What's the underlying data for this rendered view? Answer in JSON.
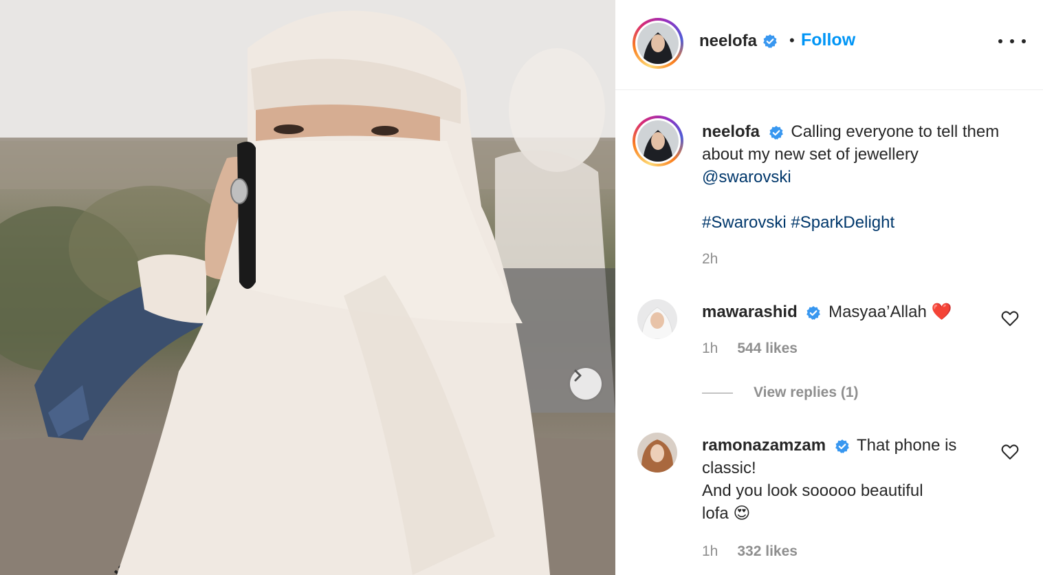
{
  "post": {
    "author": "neelofa",
    "follow_label": "Follow",
    "separator": "•",
    "caption_line1": "Calling everyone to tell them",
    "caption_line2": "about my new set of jewellery",
    "mention": "@swarovski",
    "hashtags": [
      "#Swarovski",
      "#SparkDelight"
    ],
    "time": "2h"
  },
  "comments": [
    {
      "username": "mawarashid",
      "text": "Masyaa’Allah",
      "emoji": "❤️",
      "time": "1h",
      "likes": "544 likes",
      "view_replies": "View replies (1)"
    },
    {
      "username": "ramonazamzam",
      "text_line1": "That phone is",
      "text_line2": "classic!",
      "text_line3": "And you look sooooo beautiful",
      "text_line4": "lofa",
      "emoji": "😍",
      "time": "1h",
      "likes": "332 likes"
    }
  ],
  "icons": {
    "verified": "verified-badge-icon",
    "next": "chevron-right-icon",
    "more": "more-options-icon",
    "like": "heart-icon"
  },
  "colors": {
    "follow": "#0095f6",
    "link": "#00376b",
    "verified": "#3897f0",
    "muted": "#8e8e8e"
  }
}
